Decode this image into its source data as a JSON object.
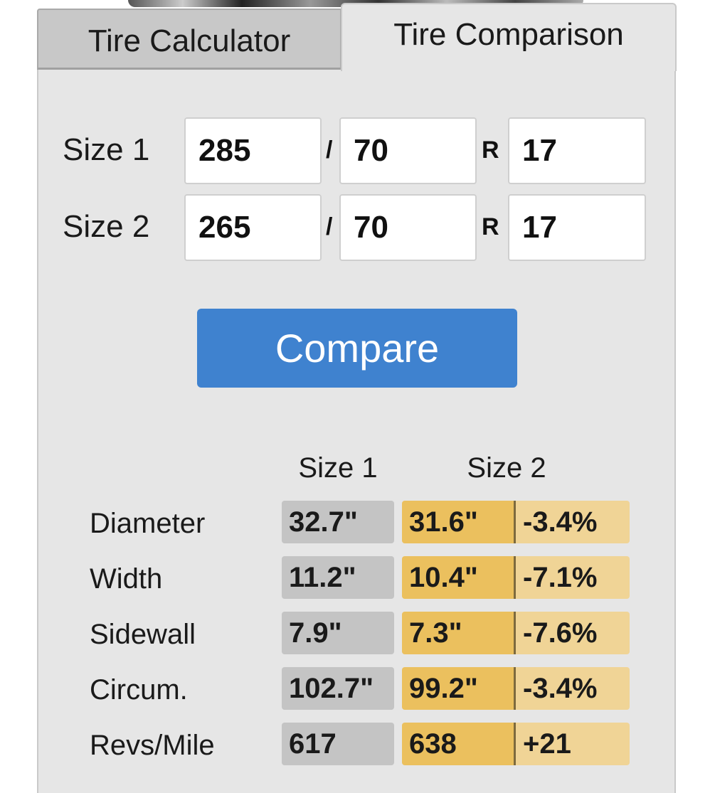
{
  "tabs": {
    "calculator": "Tire Calculator",
    "comparison": "Tire Comparison",
    "active": "comparison"
  },
  "inputs": {
    "size1": {
      "label": "Size 1",
      "width": "285",
      "aspect": "70",
      "rim": "17"
    },
    "size2": {
      "label": "Size 2",
      "width": "265",
      "aspect": "70",
      "rim": "17"
    },
    "slash": "/",
    "r": "R"
  },
  "compare_button": "Compare",
  "results": {
    "headers": {
      "size1": "Size 1",
      "size2": "Size 2"
    },
    "rows": [
      {
        "label": "Diameter",
        "size1": "32.7\"",
        "size2": "31.6\"",
        "diff": "-3.4%"
      },
      {
        "label": "Width",
        "size1": "11.2\"",
        "size2": "10.4\"",
        "diff": "-7.1%"
      },
      {
        "label": "Sidewall",
        "size1": "7.9\"",
        "size2": "7.3\"",
        "diff": "-7.6%"
      },
      {
        "label": "Circum.",
        "size1": "102.7\"",
        "size2": "99.2\"",
        "diff": "-3.4%"
      },
      {
        "label": "Revs/Mile",
        "size1": "617",
        "size2": "638",
        "diff": "+21"
      }
    ]
  },
  "colors": {
    "accent": "#3f82cf",
    "size1_cell": "#c4c4c4",
    "size2_cell": "#ebc05e",
    "diff_cell": "#f0d496"
  }
}
